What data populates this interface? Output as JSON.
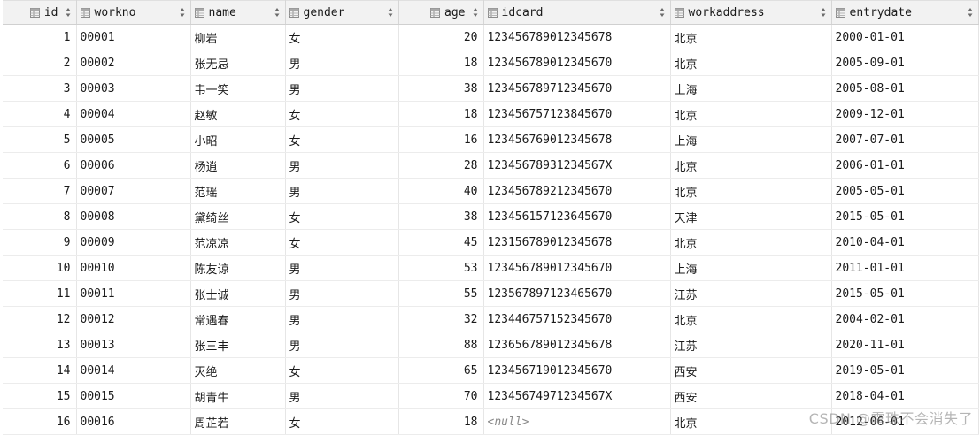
{
  "columns": [
    {
      "key": "id",
      "label": "id",
      "align": "right"
    },
    {
      "key": "workno",
      "label": "workno",
      "align": "left"
    },
    {
      "key": "name",
      "label": "name",
      "align": "left"
    },
    {
      "key": "gender",
      "label": "gender",
      "align": "left"
    },
    {
      "key": "age",
      "label": "age",
      "align": "right"
    },
    {
      "key": "idcard",
      "label": "idcard",
      "align": "left"
    },
    {
      "key": "workaddress",
      "label": "workaddress",
      "align": "left"
    },
    {
      "key": "entrydate",
      "label": "entrydate",
      "align": "left"
    }
  ],
  "rows": [
    {
      "id": "1",
      "workno": "00001",
      "name": "柳岩",
      "gender": "女",
      "age": "20",
      "idcard": "123456789012345678",
      "workaddress": "北京",
      "entrydate": "2000-01-01"
    },
    {
      "id": "2",
      "workno": "00002",
      "name": "张无忌",
      "gender": "男",
      "age": "18",
      "idcard": "123456789012345670",
      "workaddress": "北京",
      "entrydate": "2005-09-01"
    },
    {
      "id": "3",
      "workno": "00003",
      "name": "韦一笑",
      "gender": "男",
      "age": "38",
      "idcard": "123456789712345670",
      "workaddress": "上海",
      "entrydate": "2005-08-01"
    },
    {
      "id": "4",
      "workno": "00004",
      "name": "赵敏",
      "gender": "女",
      "age": "18",
      "idcard": "123456757123845670",
      "workaddress": "北京",
      "entrydate": "2009-12-01"
    },
    {
      "id": "5",
      "workno": "00005",
      "name": "小昭",
      "gender": "女",
      "age": "16",
      "idcard": "123456769012345678",
      "workaddress": "上海",
      "entrydate": "2007-07-01"
    },
    {
      "id": "6",
      "workno": "00006",
      "name": "杨逍",
      "gender": "男",
      "age": "28",
      "idcard": "12345678931234567X",
      "workaddress": "北京",
      "entrydate": "2006-01-01"
    },
    {
      "id": "7",
      "workno": "00007",
      "name": "范瑶",
      "gender": "男",
      "age": "40",
      "idcard": "123456789212345670",
      "workaddress": "北京",
      "entrydate": "2005-05-01"
    },
    {
      "id": "8",
      "workno": "00008",
      "name": "黛绮丝",
      "gender": "女",
      "age": "38",
      "idcard": "123456157123645670",
      "workaddress": "天津",
      "entrydate": "2015-05-01"
    },
    {
      "id": "9",
      "workno": "00009",
      "name": "范凉凉",
      "gender": "女",
      "age": "45",
      "idcard": "123156789012345678",
      "workaddress": "北京",
      "entrydate": "2010-04-01"
    },
    {
      "id": "10",
      "workno": "00010",
      "name": "陈友谅",
      "gender": "男",
      "age": "53",
      "idcard": "123456789012345670",
      "workaddress": "上海",
      "entrydate": "2011-01-01"
    },
    {
      "id": "11",
      "workno": "00011",
      "name": "张士诚",
      "gender": "男",
      "age": "55",
      "idcard": "123567897123465670",
      "workaddress": "江苏",
      "entrydate": "2015-05-01"
    },
    {
      "id": "12",
      "workno": "00012",
      "name": "常遇春",
      "gender": "男",
      "age": "32",
      "idcard": "123446757152345670",
      "workaddress": "北京",
      "entrydate": "2004-02-01"
    },
    {
      "id": "13",
      "workno": "00013",
      "name": "张三丰",
      "gender": "男",
      "age": "88",
      "idcard": "123656789012345678",
      "workaddress": "江苏",
      "entrydate": "2020-11-01"
    },
    {
      "id": "14",
      "workno": "00014",
      "name": "灭绝",
      "gender": "女",
      "age": "65",
      "idcard": "123456719012345670",
      "workaddress": "西安",
      "entrydate": "2019-05-01"
    },
    {
      "id": "15",
      "workno": "00015",
      "name": "胡青牛",
      "gender": "男",
      "age": "70",
      "idcard": "12345674971234567X",
      "workaddress": "西安",
      "entrydate": "2018-04-01"
    },
    {
      "id": "16",
      "workno": "00016",
      "name": "周芷若",
      "gender": "女",
      "age": "18",
      "idcard": "<null>",
      "workaddress": "北京",
      "entrydate": "2012-06-01"
    }
  ],
  "null_text": "<null>",
  "watermark": "CSDN @露珠不会消失了",
  "icons": {
    "column": "table-column-icon",
    "sort": "sort-arrows-icon"
  },
  "colors": {
    "header_bg": "#f2f2f2",
    "null_text": "#8a8a8a",
    "grid_line": "#e6e6e6"
  }
}
